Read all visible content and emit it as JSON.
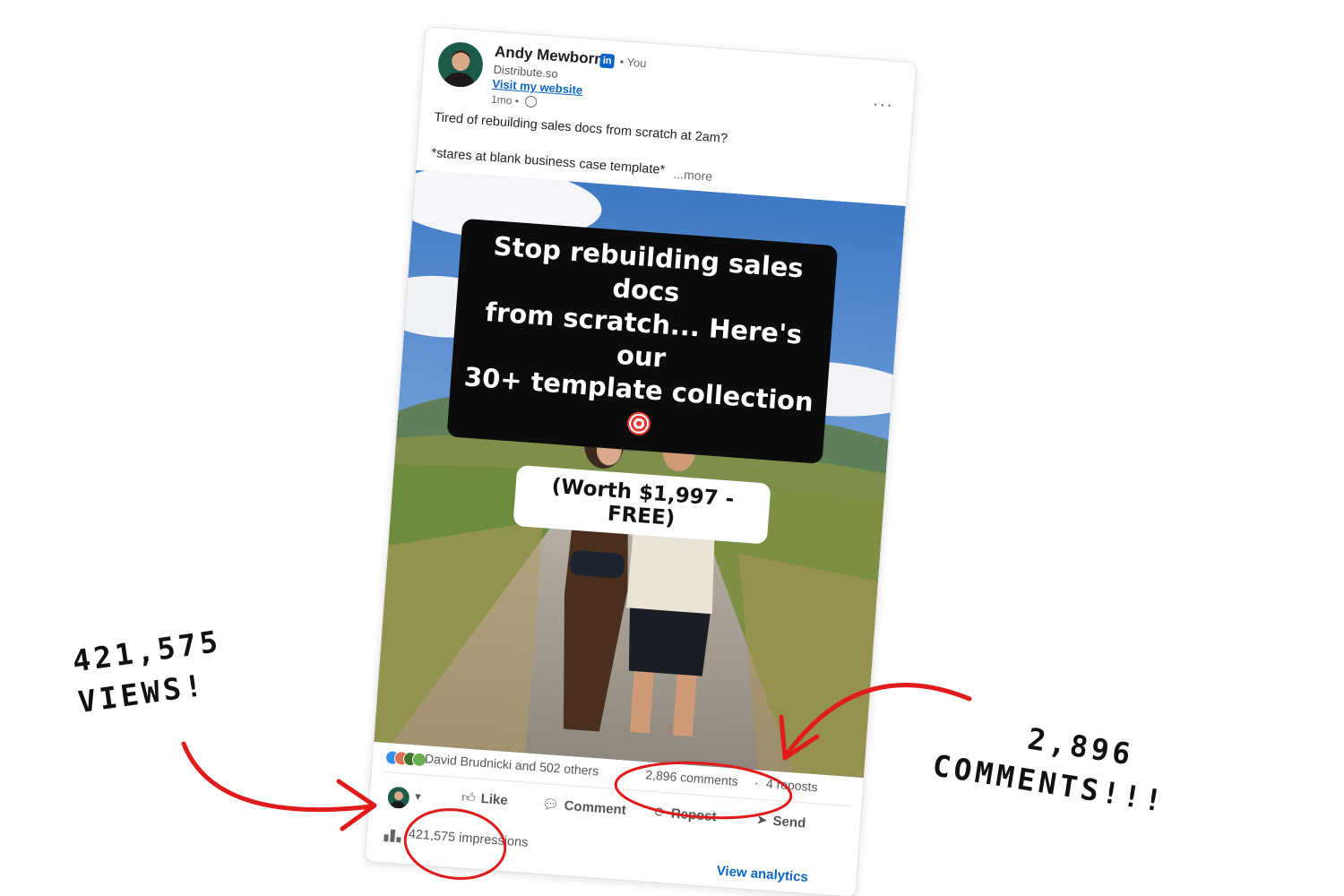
{
  "post": {
    "author_name": "Andy Mewborn",
    "linkedin_badge": "in",
    "you_label": "• You",
    "company": "Distribute.so",
    "website_link": "Visit my website",
    "time": "1mo •",
    "more_menu": "···",
    "text_line1": "Tired of rebuilding sales docs from scratch at 2am?",
    "text_line2": "*stares at blank business case template*",
    "see_more": "...more"
  },
  "image": {
    "headline_line1": "Stop rebuilding sales docs",
    "headline_line2": "from scratch... Here's our",
    "headline_line3": "30+ template collection",
    "worth_label": "(Worth $1,997 - FREE)"
  },
  "social": {
    "reactions": [
      "like",
      "love",
      "celebrate",
      "insightful"
    ],
    "likers": "David Brudnicki and 502 others",
    "comments": "2,896 comments",
    "separator": "·",
    "reposts": "4 reposts"
  },
  "actions": {
    "like": "Like",
    "comment": "Comment",
    "repost": "Repost",
    "send": "Send"
  },
  "analytics": {
    "impressions": "421,575 impressions",
    "view_analytics": "View analytics"
  },
  "annotations": {
    "views_line1": "421,575",
    "views_line2": "VIEWS!",
    "comments_line1": "2,896",
    "comments_line2": "COMMENTS!!!",
    "highlight_color": "#e01b1b"
  }
}
